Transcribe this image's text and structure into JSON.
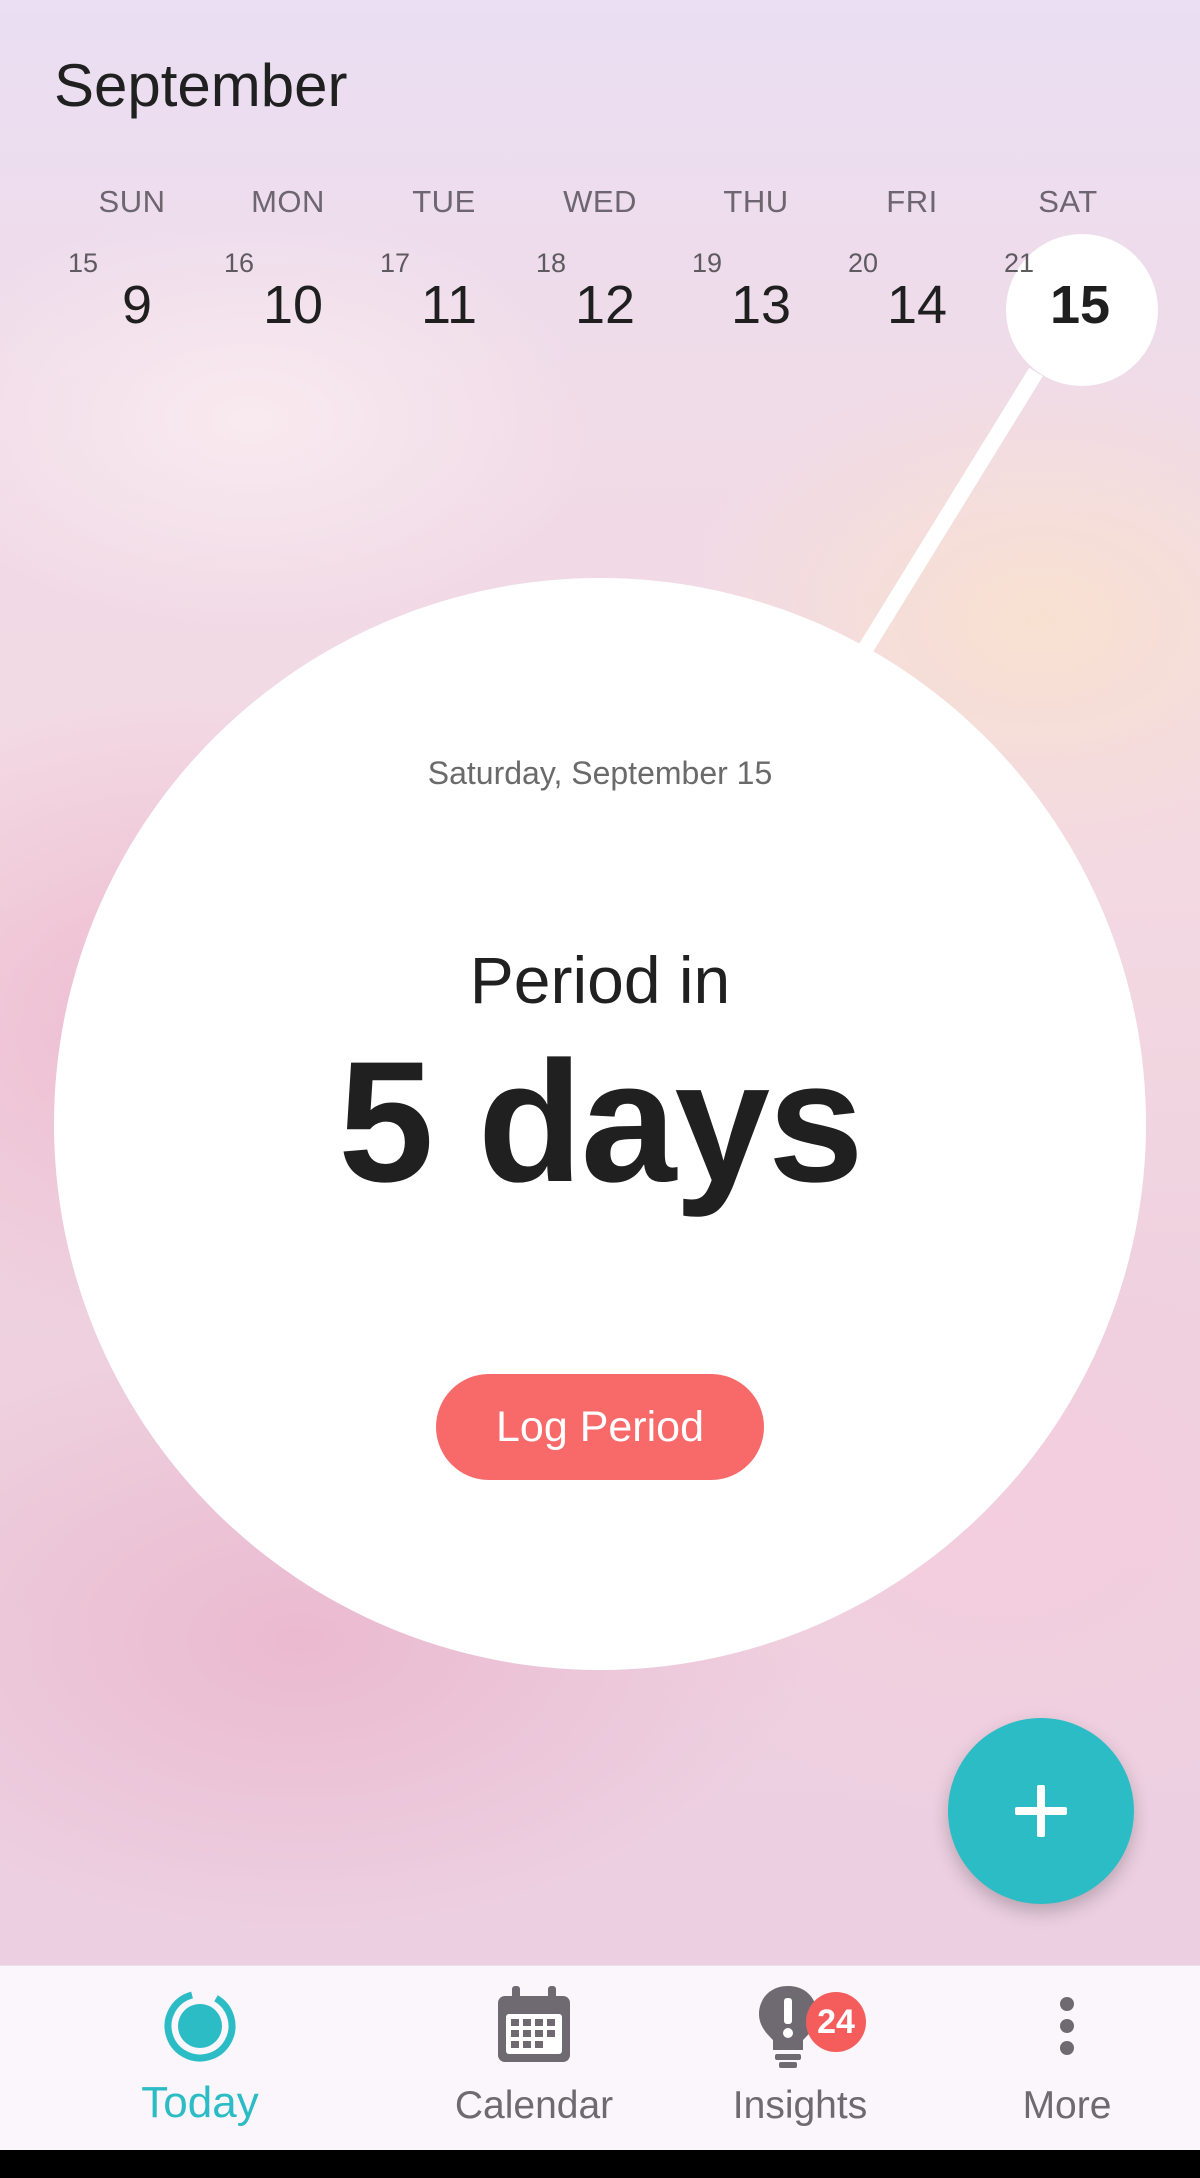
{
  "header": {
    "month": "September"
  },
  "week": {
    "days": [
      {
        "dow": "SUN",
        "cycle_day": "15",
        "date": "9",
        "selected": false
      },
      {
        "dow": "MON",
        "cycle_day": "16",
        "date": "10",
        "selected": false
      },
      {
        "dow": "TUE",
        "cycle_day": "17",
        "date": "11",
        "selected": false
      },
      {
        "dow": "WED",
        "cycle_day": "18",
        "date": "12",
        "selected": false
      },
      {
        "dow": "THU",
        "cycle_day": "19",
        "date": "13",
        "selected": false
      },
      {
        "dow": "FRI",
        "cycle_day": "20",
        "date": "14",
        "selected": false
      },
      {
        "dow": "SAT",
        "cycle_day": "21",
        "date": "15",
        "selected": true
      }
    ]
  },
  "main": {
    "date_label": "Saturday, September 15",
    "prefix": "Period in",
    "count": "5 days",
    "log_button": "Log Period"
  },
  "fab": {
    "icon": "plus-icon"
  },
  "nav": {
    "items": [
      {
        "label": "Today",
        "icon": "today-ring-icon",
        "active": true
      },
      {
        "label": "Calendar",
        "icon": "calendar-icon",
        "active": false
      },
      {
        "label": "Insights",
        "icon": "lightbulb-icon",
        "active": false,
        "badge": "24"
      },
      {
        "label": "More",
        "icon": "more-vertical-icon",
        "active": false
      }
    ]
  },
  "colors": {
    "accent": "#2bbcc5",
    "log_button": "#f86a6a",
    "badge": "#f55c5c"
  }
}
